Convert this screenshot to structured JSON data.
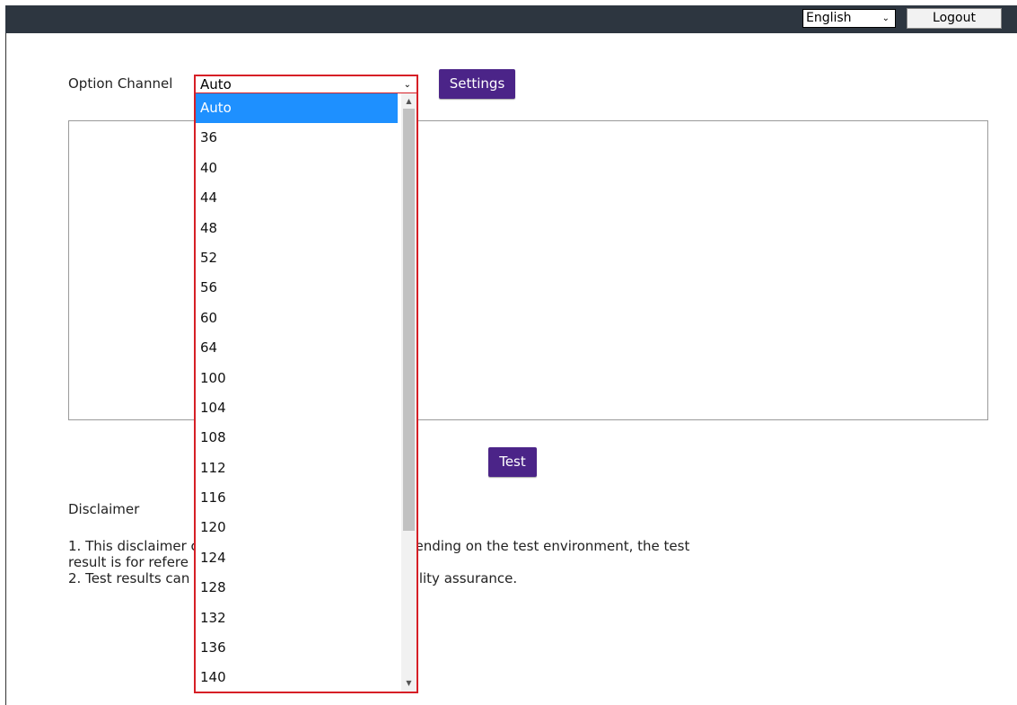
{
  "header": {
    "language": "English",
    "logout_label": "Logout"
  },
  "form": {
    "option_label": "Option Channel",
    "channel_value": "Auto",
    "settings_label": "Settings",
    "test_label": "Test"
  },
  "dropdown": {
    "options": [
      "Auto",
      "36",
      "40",
      "44",
      "48",
      "52",
      "56",
      "60",
      "64",
      "100",
      "104",
      "108",
      "112",
      "116",
      "120",
      "124",
      "128",
      "132",
      "136",
      "140"
    ],
    "selected_index": 0
  },
  "disclaimer": {
    "title": "Disclaimer",
    "visible_text": "1. This disclaimer                                                   carried out, results may vary depending on the test environment, the test\nresult is for refere\n2. Test results can                                                  rmining the product shipping quality assurance."
  },
  "colors": {
    "topbar": "#2d3640",
    "accent_purple": "#4b2488",
    "highlight_red": "#d61f26",
    "selected_blue": "#1e90ff"
  }
}
